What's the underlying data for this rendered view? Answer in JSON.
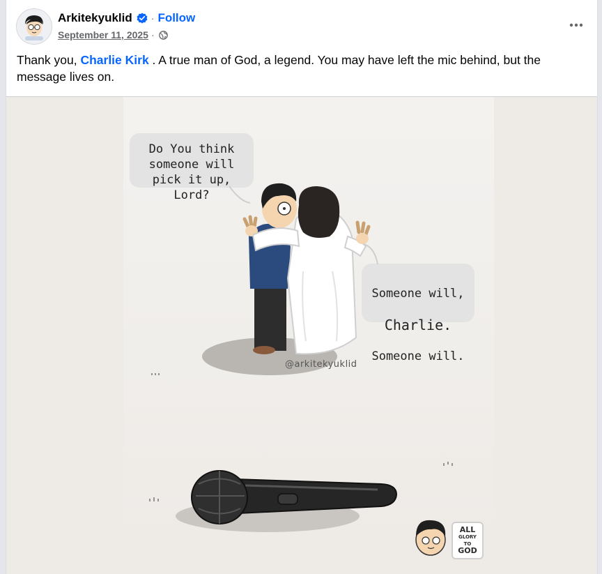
{
  "post": {
    "author": "Arkitekyuklid",
    "verified_icon": "verified-badge-icon",
    "separator": "·",
    "follow_label": "Follow",
    "date": "September 11, 2025",
    "audience_icon": "globe-icon",
    "more_icon": "more-options-icon",
    "caption_before": "Thank you, ",
    "mention": "Charlie Kirk",
    "caption_after": " . A true man of God, a legend. You may have left the mic behind, but the message lives on."
  },
  "comic": {
    "bubble_left": "Do You think\nsomeone will\npick it up, Lord?",
    "bubble_right_1": "Someone will,",
    "bubble_right_2": "Charlie.",
    "bubble_right_3": "Someone will.",
    "handle": "@arkitekyuklid",
    "badge_line1": "ALL",
    "badge_line2": "GLORY",
    "badge_line3": "TO",
    "badge_line4": "GOD"
  },
  "colors": {
    "accent": "#0866ff",
    "text": "#050505",
    "secondary": "#65676b"
  }
}
